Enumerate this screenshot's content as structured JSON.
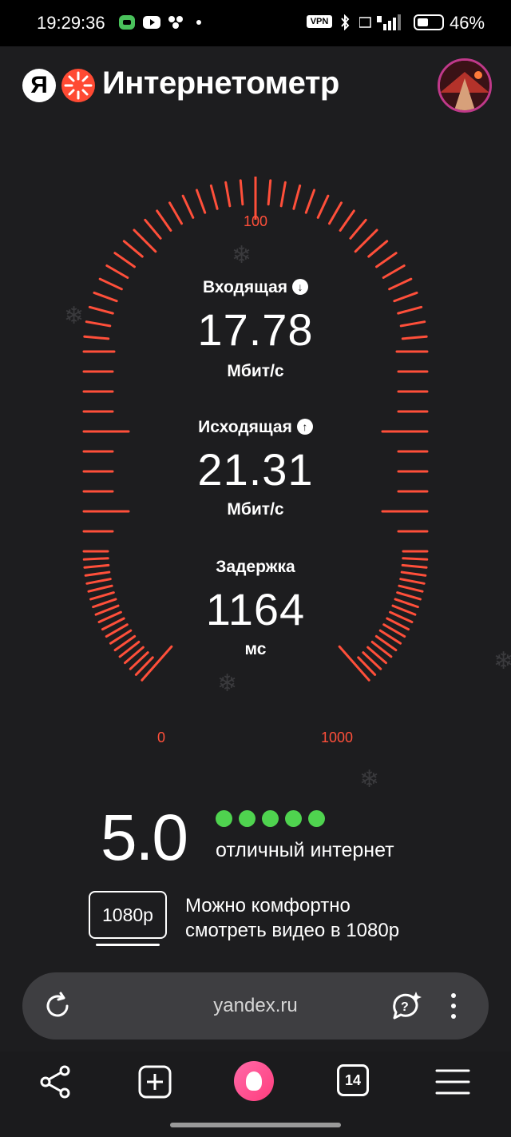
{
  "status_bar": {
    "time": "19:29:36",
    "vpn": "VPN",
    "battery_percent": "46%",
    "battery_level": 0.46
  },
  "header": {
    "logo_letter": "Я",
    "app_title": "Интернетометр"
  },
  "gauge": {
    "scale_min": "0",
    "scale_mid": "100",
    "scale_max": "1000",
    "accent_color": "#ff4f3a"
  },
  "metrics": {
    "download": {
      "label": "Входящая",
      "value": "17.78",
      "unit": "Мбит/с",
      "icon": "arrow-down-icon"
    },
    "upload": {
      "label": "Исходящая",
      "value": "21.31",
      "unit": "Мбит/с",
      "icon": "arrow-up-icon"
    },
    "latency": {
      "label": "Задержка",
      "value": "1164",
      "unit": "мс"
    }
  },
  "rating": {
    "score": "5.0",
    "dots_filled": 5,
    "dots_total": 5,
    "text": "отличный интернет",
    "color": "#4fd34f"
  },
  "video": {
    "badge": "1080p",
    "line1": "Можно комфортно",
    "line2": "смотреть видео в 1080p"
  },
  "browser": {
    "url": "yandex.ru",
    "tab_count": "14"
  }
}
